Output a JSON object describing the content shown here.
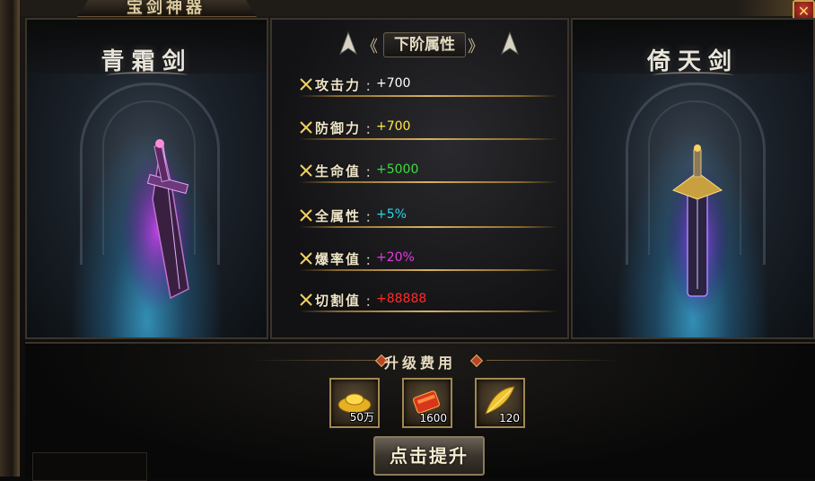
{
  "window": {
    "title": "宝剑神器",
    "close_label": "✕"
  },
  "left_sword": {
    "name": "青霜剑"
  },
  "right_sword": {
    "name": "倚天剑"
  },
  "attributes": {
    "header": "下阶属性",
    "rows": [
      {
        "label": "攻击力",
        "sep": "：",
        "value": "+700",
        "color": "#ffffff"
      },
      {
        "label": "防御力",
        "sep": "：",
        "value": "+700",
        "color": "#ffe94a"
      },
      {
        "label": "生命值",
        "sep": "：",
        "value": "+5000",
        "color": "#3ddc3d"
      },
      {
        "label": "全属性",
        "sep": "：",
        "value": "+5%",
        "color": "#29d7e6"
      },
      {
        "label": "爆率值",
        "sep": "：",
        "value": "+20%",
        "color": "#e43ae0"
      },
      {
        "label": "切割值",
        "sep": "：",
        "value": "+88888",
        "color": "#ff2a2a"
      }
    ]
  },
  "cost": {
    "title": "升级费用",
    "items": [
      {
        "icon": "gold-ingot-icon",
        "count": "50万"
      },
      {
        "icon": "red-scroll-icon",
        "count": "1600"
      },
      {
        "icon": "golden-feather-icon",
        "count": "120"
      }
    ]
  },
  "upgrade_button": {
    "label": "点击提升"
  }
}
